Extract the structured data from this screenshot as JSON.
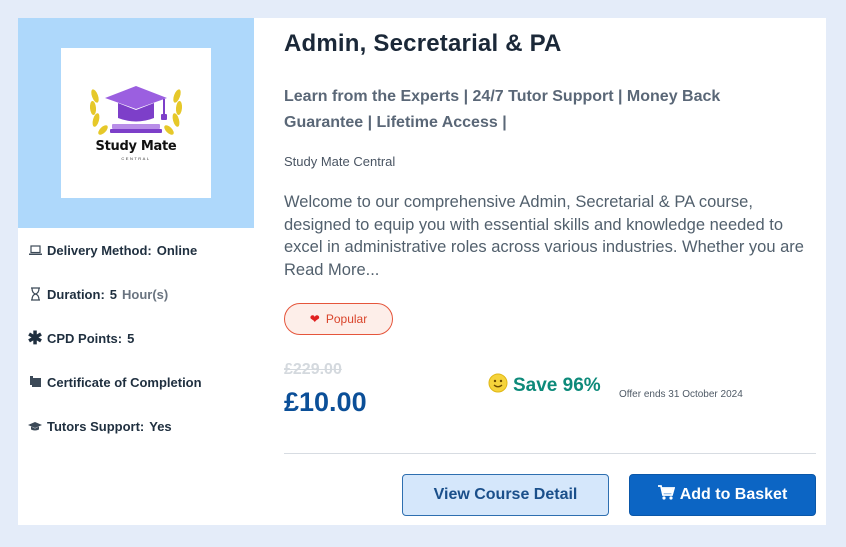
{
  "course": {
    "title": "Admin, Secretarial & PA",
    "tagline": "Learn from the Experts | 24/7 Tutor Support | Money Back Guarantee | Lifetime Access |",
    "provider": "Study Mate Central",
    "description": "Welcome to our comprehensive Admin, Secretarial & PA course, designed to equip you with essential skills and knowledge needed to excel in administrative roles across various industries. Whether you are",
    "read_more": "Read More...",
    "badge": "Popular"
  },
  "logo": {
    "name": "Study Mate",
    "sub": "CENTRAL"
  },
  "info": {
    "delivery_label": "Delivery Method:",
    "delivery_value": "Online",
    "duration_label": "Duration:",
    "duration_value": "5",
    "duration_unit": "Hour(s)",
    "cpd_label": "CPD Points:",
    "cpd_value": "5",
    "certificate_label": "Certificate of Completion",
    "tutors_label": "Tutors Support:",
    "tutors_value": "Yes"
  },
  "pricing": {
    "old_price": "£229.00",
    "price": "£10.00",
    "save": "Save 96%",
    "offer": "Offer ends 31 October 2024"
  },
  "actions": {
    "detail": "View Course Detail",
    "basket": "Add to Basket"
  },
  "icons": {
    "delivery": "laptop-icon",
    "duration": "hourglass-icon",
    "cpd": "asterisk-icon",
    "certificate": "certificate-icon",
    "tutors": "graduation-cap-icon",
    "popular": "heart-icon",
    "save": "smiley-icon",
    "basket": "cart-icon"
  },
  "colors": {
    "price": "#0b4f98",
    "save": "#0d8a7a",
    "badge": "#d9442b",
    "primary_button": "#0c65c4",
    "logo_panel": "#aed8fb"
  }
}
